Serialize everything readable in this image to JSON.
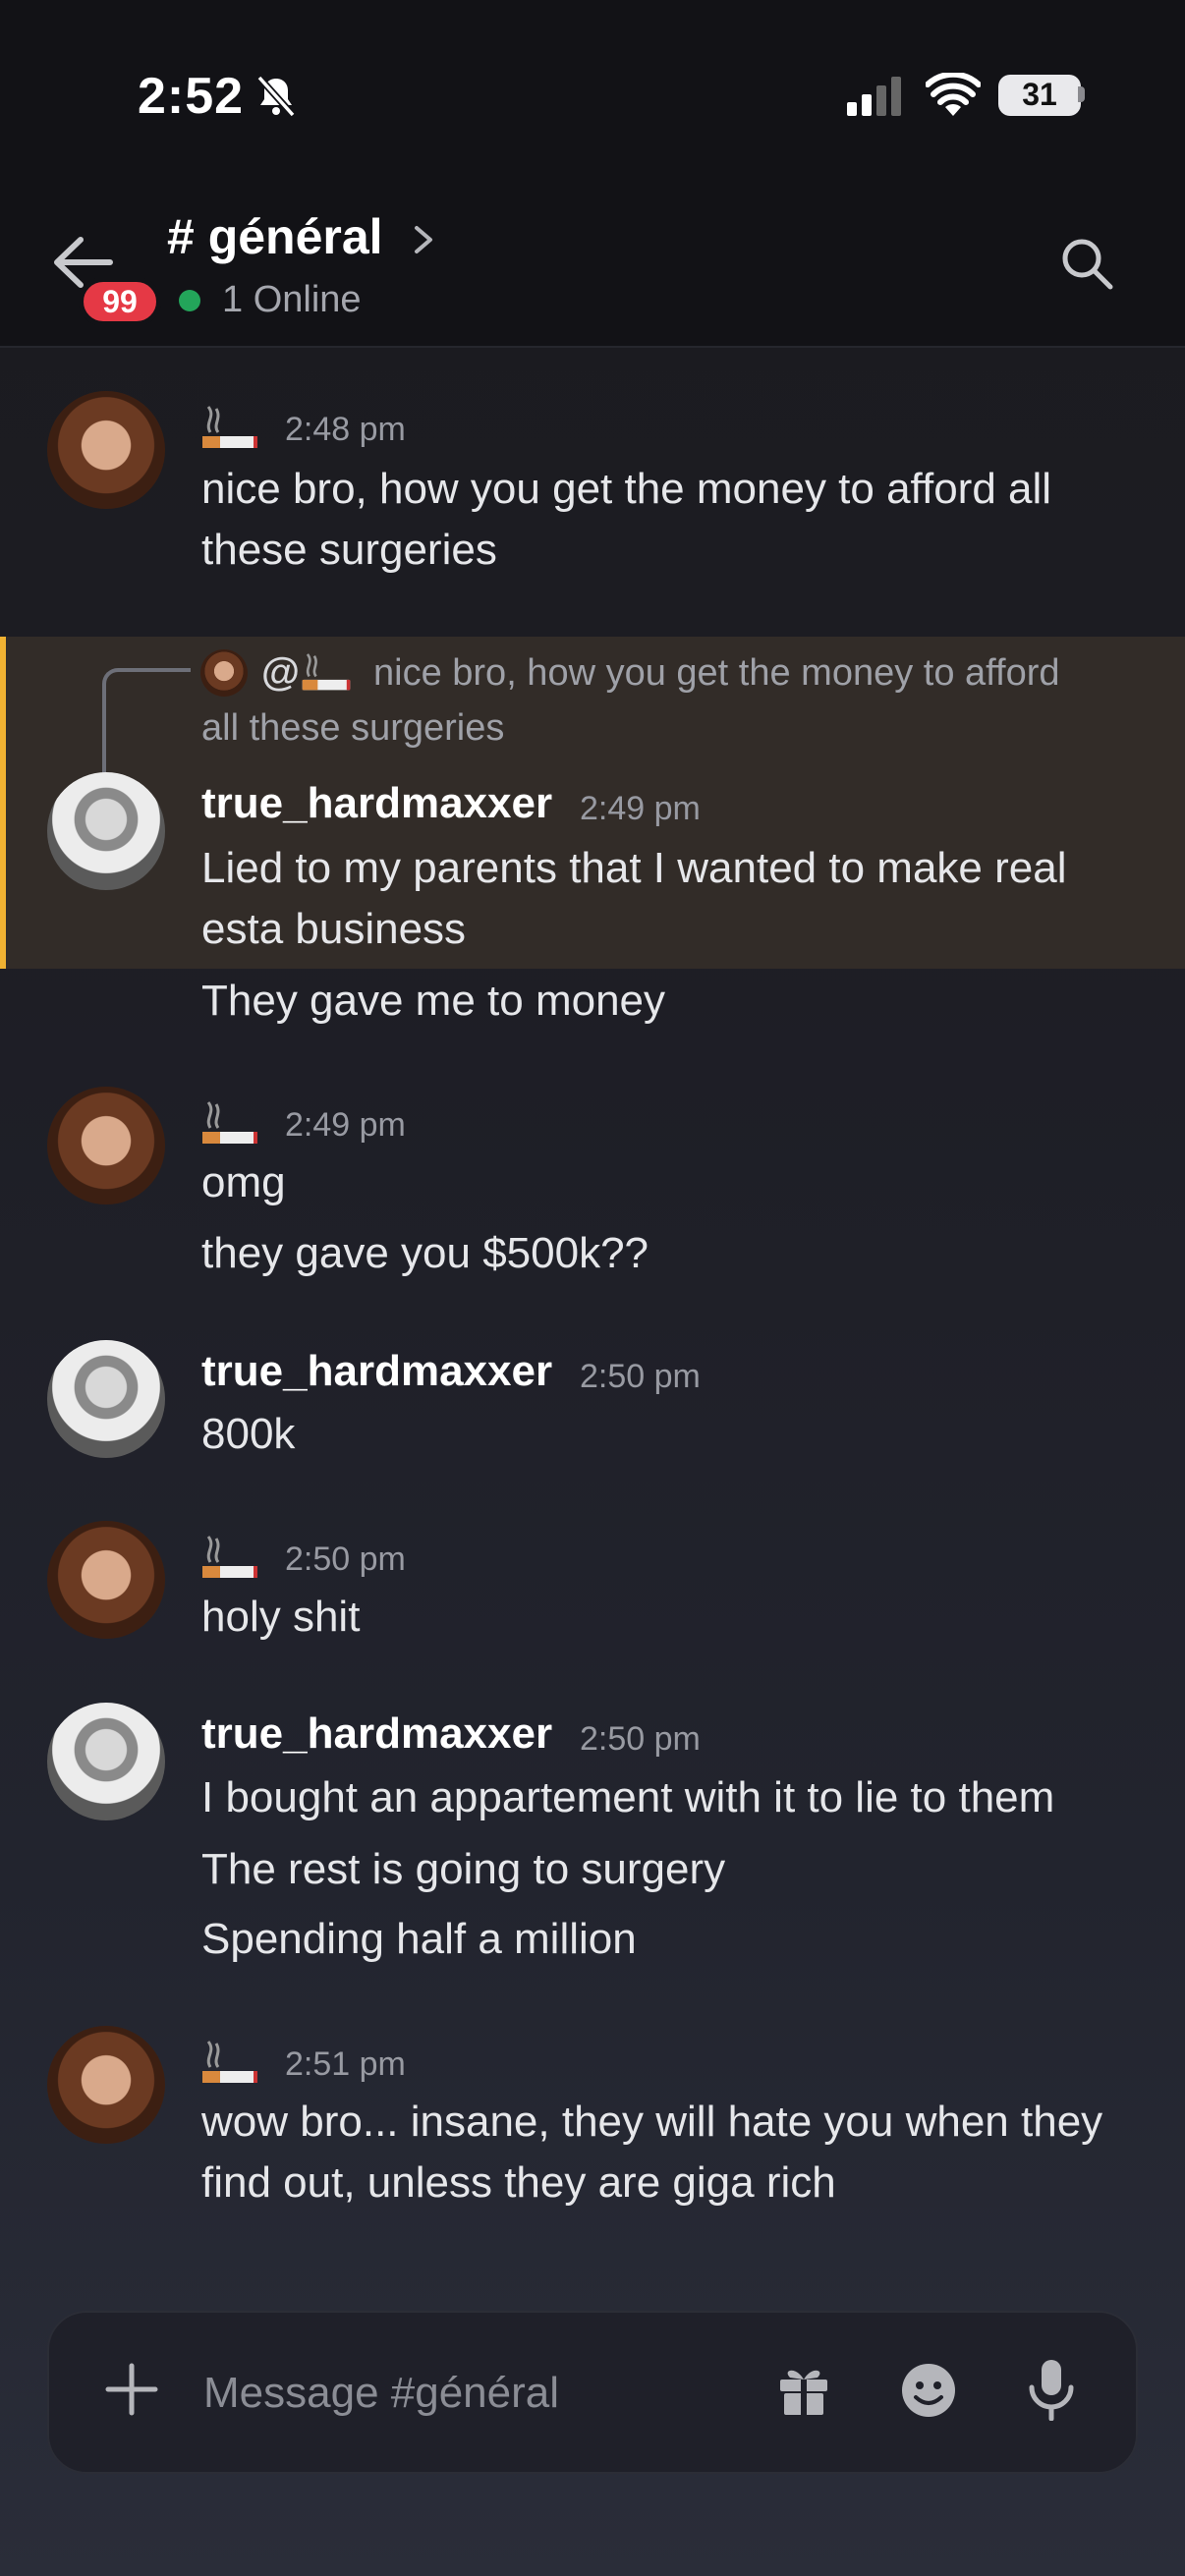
{
  "status_bar": {
    "time": "2:52",
    "battery": "31"
  },
  "header": {
    "channel": "# général",
    "unread_count": "99",
    "online": "1 Online"
  },
  "messages": [
    {
      "author_icon": "cigarette-emoji",
      "time": "2:48 pm",
      "lines": [
        "nice bro, how you get the money to afford all",
        "these surgeries"
      ]
    },
    {
      "reply": {
        "mention": "@",
        "text_line1": "nice bro, how you get the money to afford",
        "text_line2": "all these surgeries"
      },
      "author": "true_hardmaxxer",
      "time": "2:49 pm",
      "lines": [
        "Lied to my parents that I wanted to make real",
        "esta business",
        "They gave me to money"
      ],
      "highlight_color": "#f0b232"
    },
    {
      "author_icon": "cigarette-emoji",
      "time": "2:49 pm",
      "lines": [
        "omg",
        "they gave you $500k??"
      ]
    },
    {
      "author": "true_hardmaxxer",
      "time": "2:50 pm",
      "lines": [
        "800k"
      ]
    },
    {
      "author_icon": "cigarette-emoji",
      "time": "2:50 pm",
      "lines": [
        "holy shit"
      ]
    },
    {
      "author": "true_hardmaxxer",
      "time": "2:50 pm",
      "lines": [
        "I bought an appartement with it to lie to them",
        "The rest is going to surgery",
        "Spending half a million"
      ]
    },
    {
      "author_icon": "cigarette-emoji",
      "time": "2:51 pm",
      "lines": [
        "wow bro... insane, they will hate you when they",
        "find out, unless they are giga rich"
      ]
    }
  ],
  "composer": {
    "placeholder": "Message #général"
  },
  "colors": {
    "online": "#23a55a",
    "badge": "#e53945",
    "mention_highlight": "#f0b232"
  }
}
